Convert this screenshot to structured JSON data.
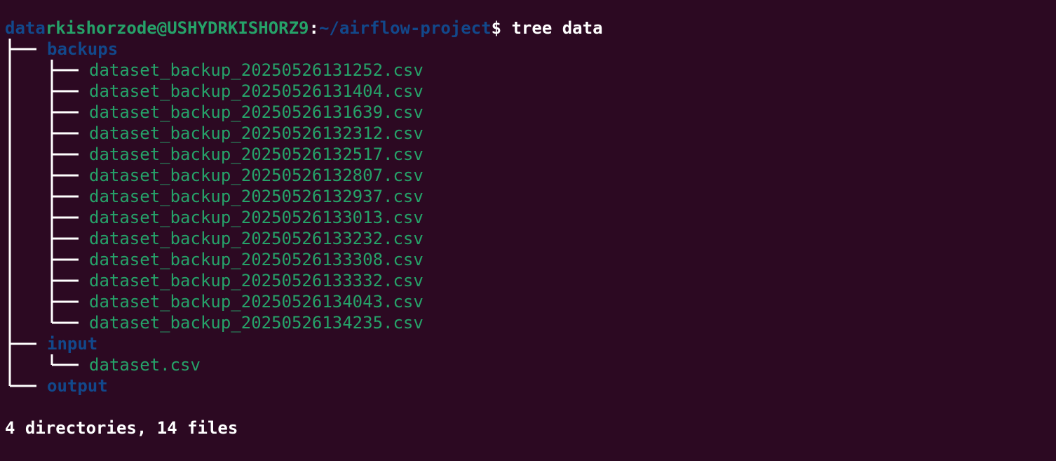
{
  "prompt": {
    "user_host": "rkishorzode@USHYDRKISHORZ9",
    "separator": ":",
    "path": "~/airflow-project",
    "symbol": "$"
  },
  "command": " tree data",
  "tree": {
    "root": "data",
    "backups_dir": "backups",
    "backup_files": [
      "dataset_backup_20250526131252.csv",
      "dataset_backup_20250526131404.csv",
      "dataset_backup_20250526131639.csv",
      "dataset_backup_20250526132312.csv",
      "dataset_backup_20250526132517.csv",
      "dataset_backup_20250526132807.csv",
      "dataset_backup_20250526132937.csv",
      "dataset_backup_20250526133013.csv",
      "dataset_backup_20250526133232.csv",
      "dataset_backup_20250526133308.csv",
      "dataset_backup_20250526133332.csv",
      "dataset_backup_20250526134043.csv",
      "dataset_backup_20250526134235.csv"
    ],
    "input_dir": "input",
    "input_file": "dataset.csv",
    "output_dir": "output"
  },
  "summary": "4 directories, 14 files",
  "colors": {
    "background": "#2c0922",
    "green": "#26a269",
    "blue": "#12488b",
    "white": "#ffffff"
  }
}
